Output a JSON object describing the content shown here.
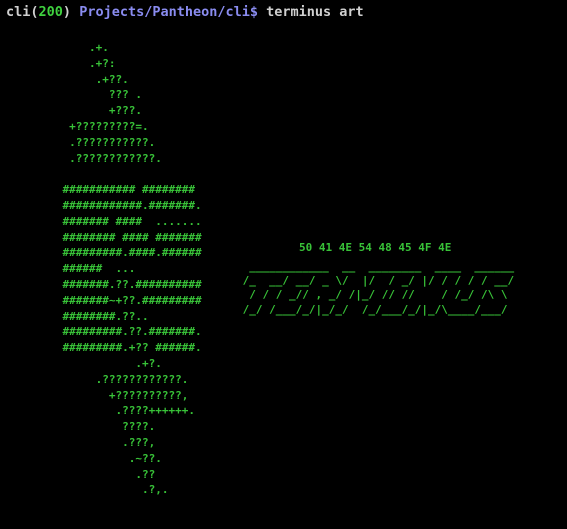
{
  "prompt": {
    "user": "cli",
    "status_open": "(",
    "status": "200",
    "status_close": ")",
    "path": "Projects/Pantheon/cli$",
    "command": "terminus art"
  },
  "art": {
    "logo": "        .+.\n        .+?:\n         .+??.\n           ??? .\n           +???.\n     +?????????=.\n     .???????????.\n     .????????????.\n\n    ########### ########\n    ############.#######.\n    ####### ####  .......\n    ######## #### #######\n    #########.####.######\n    ######  ...\n    #######.??.##########\n    #######~+??.#########\n    ########.??..\n    #########.??.#######.\n    #########.+?? ######.\n               .+?.\n         .????????????.\n           +??????????,\n            .????++++++.\n             ????.\n             .???,\n              .~??.\n               .??\n                .?,.",
    "hex": "50 41 4E 54 48 45 4F 4E",
    "banner": "  ____________  __  ________  ____  ______\n /_  __/ __/ _ \\/  |/  / _/ |/ / / / / __/\n  / / / _// , _/ /|_/ // //    / /_/ /\\ \\\n /_/ /___/_/|_/_/  /_/___/_/|_/\\____/___/"
  },
  "colors": {
    "background": "#000000",
    "art_green": "#38c238",
    "status_green": "#3fd13f",
    "path_blue": "#8a8cf0",
    "text": "#d0d0d0"
  }
}
